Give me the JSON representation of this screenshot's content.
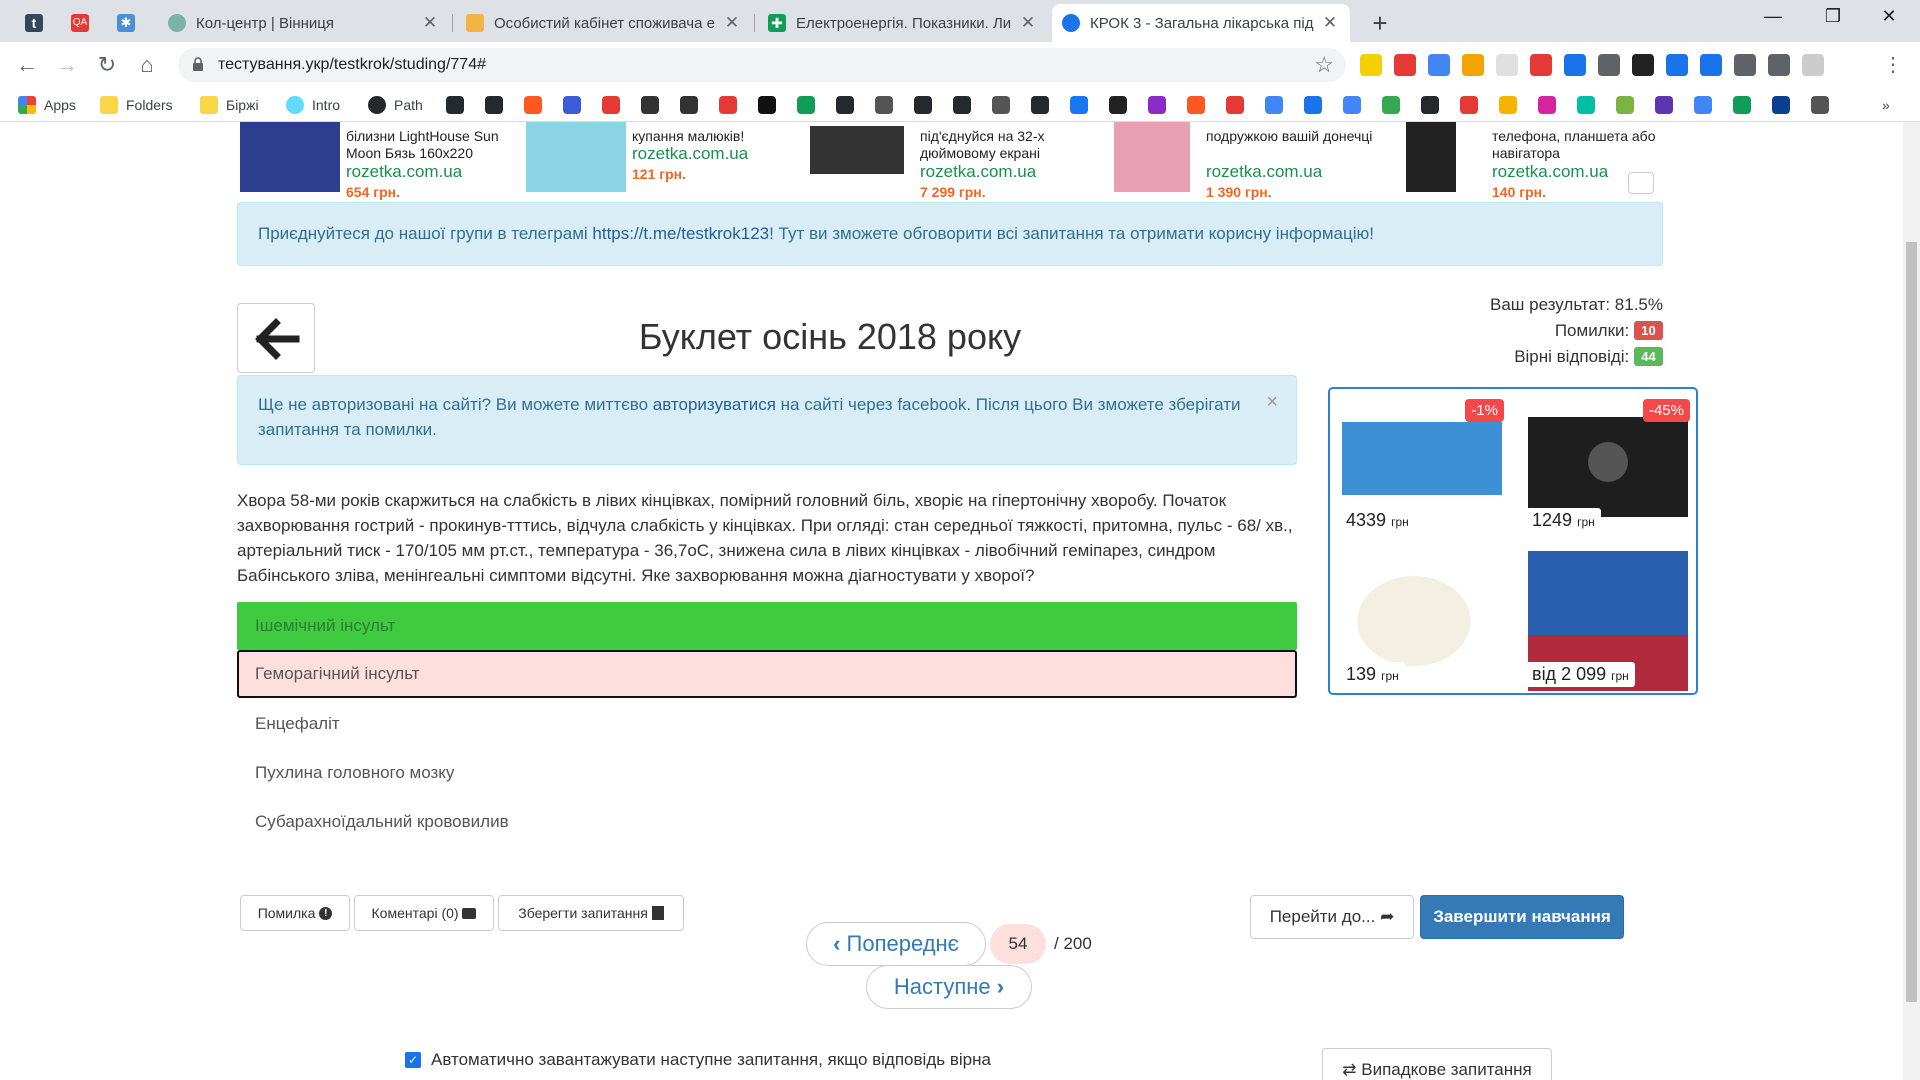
{
  "browser": {
    "pinned_tabs": [
      {
        "name": "tumblr",
        "color": "#35465c"
      },
      {
        "name": "qa",
        "color": "#e53935"
      },
      {
        "name": "settings",
        "color": "#4a90d9"
      }
    ],
    "tabs": [
      {
        "title": "Кол-центр | Вінниця",
        "close": "✕",
        "color": "#7bb3a7"
      },
      {
        "title": "Особистий кабінет споживача е",
        "close": "✕",
        "color": "#f2b544"
      },
      {
        "title": "Електроенергія. Показники. Ли",
        "close": "✕",
        "color": "#0f9d58"
      },
      {
        "title": "КРОК 3 - Загальна лікарська під",
        "close": "✕",
        "color": "#1a73e8"
      }
    ],
    "new_tab": "+",
    "window_controls": {
      "minimize": "—",
      "maximize": "❐",
      "close": "✕"
    },
    "nav": {
      "back": "←",
      "forward": "→",
      "reload": "↻",
      "home": "⌂"
    },
    "url": "тестування.укр/testkrok/studing/774#",
    "star": "☆",
    "bookmarks": [
      {
        "label": "Apps",
        "icon": "apps-icon",
        "color": "#4285f4"
      },
      {
        "label": "Folders",
        "icon": "folder-icon",
        "color": "#f9d648"
      },
      {
        "label": "Біржі",
        "icon": "folder-icon",
        "color": "#f9d648"
      },
      {
        "label": "Intro",
        "icon": "react-icon",
        "color": "#61dafb"
      },
      {
        "label": "Path",
        "icon": "github-icon",
        "color": "#24292e"
      }
    ],
    "more": "»"
  },
  "ads": [
    {
      "text": "білизни LightHouse Sun Moon Бязь 160x220",
      "site": "rozetka.com.ua",
      "price": "654 грн.",
      "color": "#2d3e8f"
    },
    {
      "text": "купання малюків!",
      "site": "rozetka.com.ua",
      "price": "121 грн.",
      "color": "#8ad4e6"
    },
    {
      "text": "під'єднуйся на 32-х дюймовому екрані",
      "site": "rozetka.com.ua",
      "price": "7 299 грн.",
      "color": "#333333"
    },
    {
      "text": "подружкою вашій донечці",
      "site": "rozetka.com.ua",
      "price": "1 390 грн.",
      "color": "#e8a0b4"
    },
    {
      "text": "телефона, планшета або навігатора",
      "site": "rozetka.com.ua",
      "price": "140 грн.",
      "color": "#222222"
    }
  ],
  "telegram_alert": {
    "before": "Приєднуйтеся до нашої групи в телеграмі ",
    "link": "https://t.me/testkrok123",
    "after": "! Тут ви зможете обговорити всі запитання та отримати корисну інформацію!"
  },
  "page": {
    "title": "Буклет осінь 2018 року",
    "back_arrow": "←"
  },
  "stats": {
    "result_label": "Ваш результат: 81.5%",
    "errors_label": "Помилки:",
    "errors_count": "10",
    "correct_label": "Вірні відповіді:",
    "correct_count": "44"
  },
  "auth_alert": {
    "before": "Ще не авторизовані на сайті? Ви можете миттєво ",
    "link": "авторизуватися",
    "after": " на сайті через facebook. Після цього Ви зможете зберігати запитання та помилки.",
    "close": "×"
  },
  "question": {
    "text": "Хвора 58-ми років скаржиться на слабкість в лівих кінцівках, помірний головний біль, хворіє на гіпертонічну хворобу. Початок захворювання гострий - прокинув-тттись, відчула слабкість у кінцівках. При огляді: стан середньої тяжкості, притомна, пульс - 68/ хв., артеріальний тиск - 170/105 мм рт.ст., температура - 36,7оС, знижена сила в лівих кінцівках - лівобічний геміпарез, синдром Бабінського зліва, менінгеальні симптоми відсутні. Яке захворювання можна діагностувати у хворої?",
    "answers": [
      {
        "text": "Ішемічний інсульт",
        "state": "correct"
      },
      {
        "text": "Геморагічний інсульт",
        "state": "wrong"
      },
      {
        "text": "Енцефаліт",
        "state": "none"
      },
      {
        "text": "Пухлина головного мозку",
        "state": "none"
      },
      {
        "text": "Субарахноїдальний крововилив",
        "state": "none"
      }
    ]
  },
  "shop": {
    "items": [
      {
        "price": "4339",
        "currency": "грн",
        "discount": "-1%",
        "color": "#3d8fd6"
      },
      {
        "price": "1249",
        "currency": "грн",
        "discount": "-45%",
        "color": "#1e1e1e"
      },
      {
        "price": "139",
        "currency": "грн",
        "discount": "",
        "color": "#e7e2d0"
      },
      {
        "price": "від 2 099",
        "currency": "грн",
        "discount": "",
        "color": "#b02b3b"
      }
    ]
  },
  "actions": {
    "error": "Помилка",
    "comments": "Коментарі (0)",
    "save": "Зберегти запитання",
    "goto": "Перейти до...",
    "finish": "Завершити навчання",
    "prev": "Попереднє",
    "next": "Наступне",
    "current": "54",
    "total": "/ 200",
    "autoload": "Автоматично завантажувати наступне запитання, якщо відповідь вірна",
    "random": "Випадкове запитання"
  }
}
